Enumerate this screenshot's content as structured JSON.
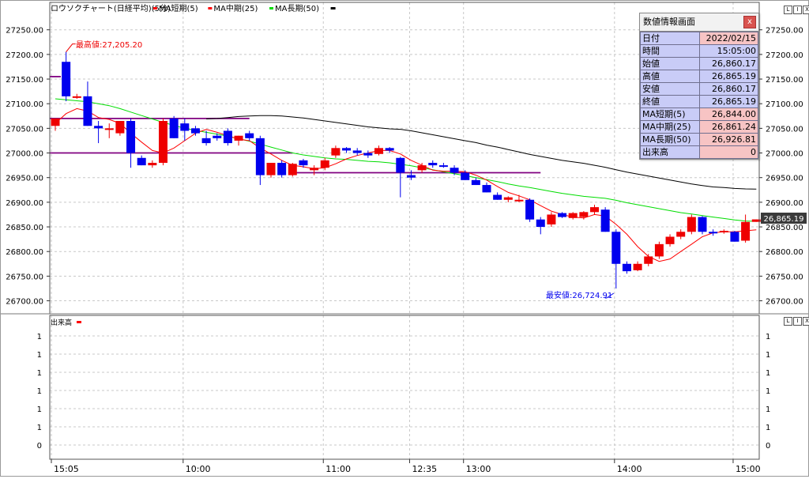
{
  "header": {
    "title": "ロウソクチャート(日経平均)(5分)",
    "legend": [
      {
        "label": "MA短期(5)",
        "color": "#ff0000"
      },
      {
        "label": "MA中期(25)",
        "color": "#ff0000"
      },
      {
        "label": "MA長期(50)",
        "color": "#00dd00"
      }
    ],
    "last_marker_color": "#000000"
  },
  "annotations": {
    "high_label": "最高値:27,205.20",
    "low_label": "最安値:26,724.91",
    "last_price": "26,865.19"
  },
  "volume_pane": {
    "title": "出来高",
    "title_marker_color": "#ff0000",
    "ticks": [
      "1",
      "1",
      "1",
      "1",
      "1",
      "1",
      "0"
    ]
  },
  "price_ticks": [
    "27250.00",
    "27200.00",
    "27150.00",
    "27100.00",
    "27050.00",
    "27000.00",
    "26950.00",
    "26900.00",
    "26850.00",
    "26800.00",
    "26750.00",
    "26700.00"
  ],
  "time_ticks": [
    "15:05",
    "10:00",
    "11:00",
    "12:35",
    "13:00",
    "14:00",
    "15:00"
  ],
  "data_window": {
    "title": "数値情報画面",
    "close_label": "x",
    "rows": [
      {
        "key": "日付",
        "value": "2022/02/15",
        "highlight": true
      },
      {
        "key": "時間",
        "value": "15:05:00",
        "highlight": false
      },
      {
        "key": "始値",
        "value": "26,860.17",
        "highlight": false
      },
      {
        "key": "高値",
        "value": "26,865.19",
        "highlight": false
      },
      {
        "key": "安値",
        "value": "26,860.17",
        "highlight": false
      },
      {
        "key": "終値",
        "value": "26,865.19",
        "highlight": false
      },
      {
        "key": "MA短期(5)",
        "value": "26,844.00",
        "highlight": true
      },
      {
        "key": "MA中期(25)",
        "value": "26,861.24",
        "highlight": true
      },
      {
        "key": "MA長期(50)",
        "value": "26,926.81",
        "highlight": true
      },
      {
        "key": "出来高",
        "value": "0",
        "highlight": true
      }
    ]
  },
  "colors": {
    "up": "#ee0000",
    "down": "#0000ee",
    "ma_short": "#ff0000",
    "ma_mid": "#00dd00",
    "ma_long": "#000000",
    "hline": "#800080",
    "grid": "#c8c8c8"
  },
  "window_buttons": [
    "L",
    "I",
    "X"
  ],
  "chart_data": {
    "type": "candlestick",
    "ylim": [
      26680,
      27280
    ],
    "candles": [
      {
        "o": 27055,
        "h": 27070,
        "l": 27045,
        "c": 27070
      },
      {
        "o": 27185,
        "h": 27205.2,
        "l": 27105,
        "c": 27115
      },
      {
        "o": 27115,
        "h": 27120,
        "l": 27110,
        "c": 27115
      },
      {
        "o": 27115,
        "h": 27145,
        "l": 27055,
        "c": 27055
      },
      {
        "o": 27055,
        "h": 27065,
        "l": 27020,
        "c": 27050
      },
      {
        "o": 27050,
        "h": 27060,
        "l": 27030,
        "c": 27050
      },
      {
        "o": 27040,
        "h": 27065,
        "l": 27035,
        "c": 27065
      },
      {
        "o": 27065,
        "h": 27070,
        "l": 26970,
        "c": 27000
      },
      {
        "o": 26990,
        "h": 26995,
        "l": 26975,
        "c": 26975
      },
      {
        "o": 26975,
        "h": 26985,
        "l": 26970,
        "c": 26980
      },
      {
        "o": 26980,
        "h": 27070,
        "l": 26975,
        "c": 27065
      },
      {
        "o": 27070,
        "h": 27075,
        "l": 27030,
        "c": 27030
      },
      {
        "o": 27060,
        "h": 27070,
        "l": 27025,
        "c": 27045
      },
      {
        "o": 27050,
        "h": 27055,
        "l": 27035,
        "c": 27040
      },
      {
        "o": 27030,
        "h": 27045,
        "l": 27015,
        "c": 27020
      },
      {
        "o": 27035,
        "h": 27040,
        "l": 27025,
        "c": 27030
      },
      {
        "o": 27045,
        "h": 27050,
        "l": 27015,
        "c": 27020
      },
      {
        "o": 27025,
        "h": 27035,
        "l": 27015,
        "c": 27035
      },
      {
        "o": 27040,
        "h": 27045,
        "l": 27025,
        "c": 27030
      },
      {
        "o": 27030,
        "h": 27035,
        "l": 26935,
        "c": 26955
      },
      {
        "o": 26955,
        "h": 26980,
        "l": 26950,
        "c": 26980
      },
      {
        "o": 26980,
        "h": 26985,
        "l": 26950,
        "c": 26955
      },
      {
        "o": 26955,
        "h": 26980,
        "l": 26952,
        "c": 26978
      },
      {
        "o": 26985,
        "h": 26988,
        "l": 26970,
        "c": 26975
      },
      {
        "o": 26965,
        "h": 26975,
        "l": 26955,
        "c": 26970
      },
      {
        "o": 26970,
        "h": 26990,
        "l": 26965,
        "c": 26985
      },
      {
        "o": 26995,
        "h": 27015,
        "l": 26990,
        "c": 27010
      },
      {
        "o": 27010,
        "h": 27012,
        "l": 27000,
        "c": 27005
      },
      {
        "o": 27005,
        "h": 27010,
        "l": 26995,
        "c": 27000
      },
      {
        "o": 27000,
        "h": 27005,
        "l": 26990,
        "c": 26995
      },
      {
        "o": 26998,
        "h": 27015,
        "l": 26995,
        "c": 27010
      },
      {
        "o": 27010,
        "h": 27012,
        "l": 27000,
        "c": 27005
      },
      {
        "o": 26990,
        "h": 26992,
        "l": 26910,
        "c": 26960
      },
      {
        "o": 26955,
        "h": 26965,
        "l": 26945,
        "c": 26950
      },
      {
        "o": 26965,
        "h": 26980,
        "l": 26960,
        "c": 26975
      },
      {
        "o": 26980,
        "h": 26985,
        "l": 26970,
        "c": 26975
      },
      {
        "o": 26975,
        "h": 26980,
        "l": 26970,
        "c": 26972
      },
      {
        "o": 26970,
        "h": 26975,
        "l": 26955,
        "c": 26960
      },
      {
        "o": 26960,
        "h": 26965,
        "l": 26945,
        "c": 26945
      },
      {
        "o": 26945,
        "h": 26950,
        "l": 26935,
        "c": 26935
      },
      {
        "o": 26935,
        "h": 26940,
        "l": 26920,
        "c": 26920
      },
      {
        "o": 26915,
        "h": 26920,
        "l": 26905,
        "c": 26905
      },
      {
        "o": 26905,
        "h": 26912,
        "l": 26900,
        "c": 26910
      },
      {
        "o": 26905,
        "h": 26915,
        "l": 26900,
        "c": 26905
      },
      {
        "o": 26905,
        "h": 26908,
        "l": 26860,
        "c": 26865
      },
      {
        "o": 26865,
        "h": 26870,
        "l": 26835,
        "c": 26850
      },
      {
        "o": 26855,
        "h": 26880,
        "l": 26850,
        "c": 26875
      },
      {
        "o": 26878,
        "h": 26880,
        "l": 26868,
        "c": 26870
      },
      {
        "o": 26868,
        "h": 26880,
        "l": 26865,
        "c": 26878
      },
      {
        "o": 26870,
        "h": 26882,
        "l": 26865,
        "c": 26880
      },
      {
        "o": 26880,
        "h": 26895,
        "l": 26875,
        "c": 26890
      },
      {
        "o": 26885,
        "h": 26890,
        "l": 26840,
        "c": 26840
      },
      {
        "o": 26840,
        "h": 26845,
        "l": 26724.91,
        "c": 26775
      },
      {
        "o": 26775,
        "h": 26780,
        "l": 26755,
        "c": 26760
      },
      {
        "o": 26762,
        "h": 26780,
        "l": 26760,
        "c": 26775
      },
      {
        "o": 26775,
        "h": 26795,
        "l": 26770,
        "c": 26790
      },
      {
        "o": 26790,
        "h": 26820,
        "l": 26785,
        "c": 26815
      },
      {
        "o": 26815,
        "h": 26835,
        "l": 26810,
        "c": 26830
      },
      {
        "o": 26830,
        "h": 26845,
        "l": 26825,
        "c": 26840
      },
      {
        "o": 26840,
        "h": 26875,
        "l": 26835,
        "c": 26870
      },
      {
        "o": 26870,
        "h": 26872,
        "l": 26835,
        "c": 26840
      },
      {
        "o": 26840,
        "h": 26845,
        "l": 26832,
        "c": 26838
      },
      {
        "o": 26840,
        "h": 26845,
        "l": 26836,
        "c": 26842
      },
      {
        "o": 26840,
        "h": 26842,
        "l": 26820,
        "c": 26820
      },
      {
        "o": 26822,
        "h": 26875,
        "l": 26818,
        "c": 26860
      },
      {
        "o": 26860.17,
        "h": 26865.19,
        "l": 26860.17,
        "c": 26865.19
      }
    ],
    "ma_short": [
      27060,
      27080,
      27090,
      27085,
      27072,
      27068,
      27060,
      27040,
      27022,
      27005,
      27000,
      27010,
      27025,
      27040,
      27048,
      27042,
      27035,
      27028,
      27025,
      27010,
      26998,
      26985,
      26975,
      26972,
      26968,
      26970,
      26978,
      26988,
      26995,
      27000,
      27005,
      27005,
      26998,
      26985,
      26975,
      26965,
      26963,
      26963,
      26962,
      26955,
      26945,
      26932,
      26920,
      26913,
      26905,
      26893,
      26882,
      26875,
      26870,
      26868,
      26875,
      26872,
      26855,
      26835,
      26810,
      26790,
      26780,
      26785,
      26800,
      26815,
      26830,
      26838,
      26840,
      26840,
      26842,
      26844
    ],
    "ma_mid": [
      27110,
      27108,
      27106,
      27104,
      27100,
      27096,
      27090,
      27083,
      27076,
      27069,
      27062,
      27056,
      27050,
      27046,
      27042,
      27038,
      27034,
      27029,
      27024,
      27018,
      27012,
      27006,
      27000,
      26996,
      26993,
      26990,
      26988,
      26987,
      26985,
      26983,
      26982,
      26980,
      26977,
      26974,
      26970,
      26966,
      26962,
      26958,
      26954,
      26950,
      26946,
      26942,
      26937,
      26933,
      26930,
      26926,
      26922,
      26918,
      26915,
      26912,
      26910,
      26908,
      26904,
      26899,
      26895,
      26891,
      26887,
      26883,
      26879,
      26876,
      26873,
      26870,
      26867,
      26864,
      26862,
      26861.24
    ],
    "ma_long": [
      null,
      null,
      null,
      null,
      null,
      null,
      null,
      null,
      null,
      null,
      null,
      null,
      null,
      null,
      27069,
      27070,
      27072,
      27074,
      27075,
      27076,
      27076,
      27075,
      27073,
      27071,
      27068,
      27065,
      27062,
      27059,
      27056,
      27053,
      27051,
      27049,
      27048,
      27045,
      27041,
      27037,
      27033,
      27029,
      27025,
      27021,
      27016,
      27012,
      27007,
      27002,
      26997,
      26993,
      26989,
      26985,
      26982,
      26979,
      26975,
      26971,
      26966,
      26961,
      26957,
      26953,
      26949,
      26945,
      26941,
      26937,
      26934,
      26931,
      26930,
      26928,
      26927,
      26926.81
    ],
    "hlines": [
      {
        "y": 27155,
        "from": 0,
        "to": 0
      },
      {
        "y": 27070,
        "from": 0,
        "to": 18
      },
      {
        "y": 27000,
        "from": 0,
        "to": 22
      },
      {
        "y": 26960,
        "from": 22,
        "to": 45
      }
    ],
    "volume_ylim": [
      0,
      1
    ]
  }
}
